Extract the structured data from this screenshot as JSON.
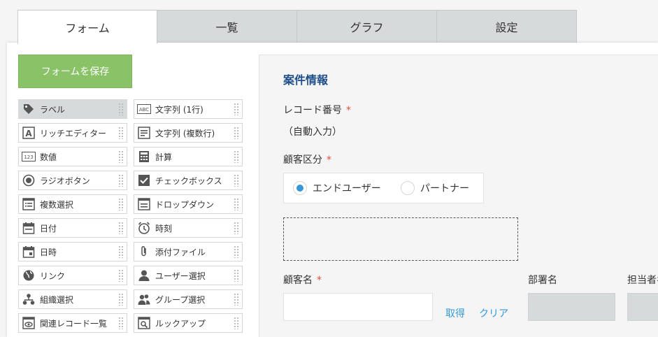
{
  "tabs": [
    {
      "label": "フォーム",
      "active": true
    },
    {
      "label": "一覧"
    },
    {
      "label": "グラフ"
    },
    {
      "label": "設定"
    }
  ],
  "save_button": "フォームを保存",
  "palette": [
    {
      "label": "ラベル",
      "icon": "tag-icon"
    },
    {
      "label": "文字列 (1行)",
      "icon": "abc-icon"
    },
    {
      "label": "リッチエディター",
      "icon": "rich-editor-icon"
    },
    {
      "label": "文字列 (複数行)",
      "icon": "multiline-text-icon"
    },
    {
      "label": "数値",
      "icon": "number-icon"
    },
    {
      "label": "計算",
      "icon": "calculator-icon"
    },
    {
      "label": "ラジオボタン",
      "icon": "radio-icon"
    },
    {
      "label": "チェックボックス",
      "icon": "checkbox-icon"
    },
    {
      "label": "複数選択",
      "icon": "multi-select-icon"
    },
    {
      "label": "ドロップダウン",
      "icon": "dropdown-icon"
    },
    {
      "label": "日付",
      "icon": "date-icon"
    },
    {
      "label": "時刻",
      "icon": "clock-icon"
    },
    {
      "label": "日時",
      "icon": "datetime-icon"
    },
    {
      "label": "添付ファイル",
      "icon": "paperclip-icon"
    },
    {
      "label": "リンク",
      "icon": "globe-icon"
    },
    {
      "label": "ユーザー選択",
      "icon": "user-icon"
    },
    {
      "label": "組織選択",
      "icon": "org-icon"
    },
    {
      "label": "グループ選択",
      "icon": "group-icon"
    },
    {
      "label": "関連レコード一覧",
      "icon": "related-records-icon"
    },
    {
      "label": "ルックアップ",
      "icon": "lookup-icon"
    }
  ],
  "form": {
    "section_title": "案件情報",
    "record_number_label": "レコード番号",
    "record_number_value": "（自動入力）",
    "customer_type_label": "顧客区分",
    "radio_options": [
      "エンドユーザー",
      "パートナー"
    ],
    "customer_name_label": "顧客名",
    "fetch_link": "取得",
    "clear_link": "クリア",
    "department_label": "部署名",
    "person_label": "担当者名",
    "required_mark": "*"
  },
  "colors": {
    "accent": "#8ac268",
    "title": "#1d4e89",
    "link": "#3498db",
    "required": "#e74c3c"
  }
}
